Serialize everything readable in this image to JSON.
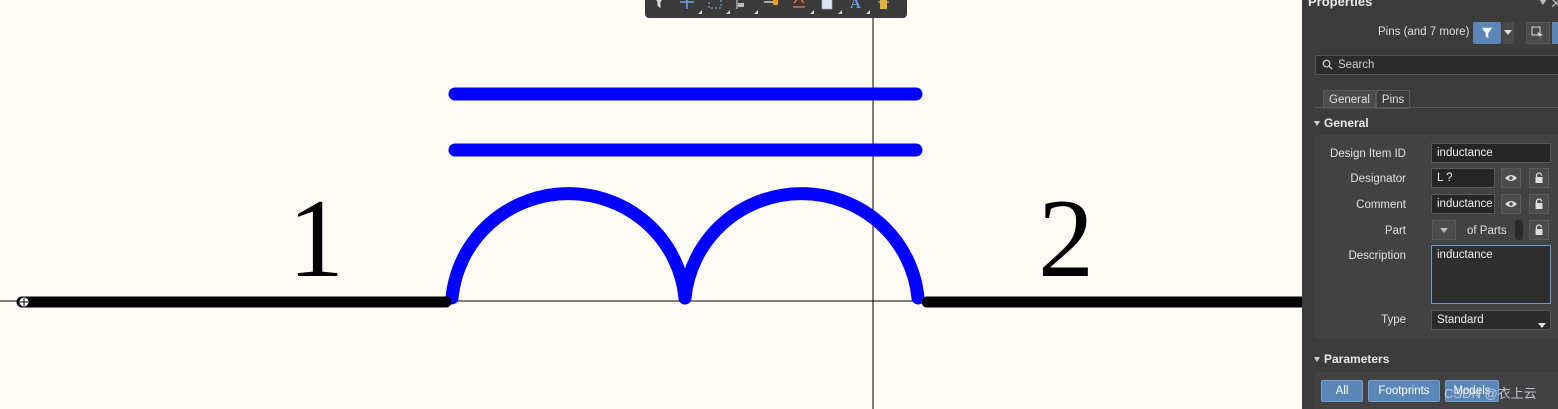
{
  "canvas": {
    "pin1_label": "1",
    "pin2_label": "2",
    "body_color": "#0000ff",
    "pin_color": "#000000",
    "background": "#fffcf5"
  },
  "toolbar": {
    "icons": [
      "filter-icon",
      "crosshair-icon",
      "select-region-icon",
      "align-icon",
      "place-pin-icon",
      "ieee-symbol-icon",
      "note-icon",
      "place-text-icon",
      "component-icon"
    ]
  },
  "properties": {
    "title": "Properties",
    "filter_summary": "Pins (and 7 more)",
    "search_placeholder": "Search",
    "tabs": [
      "General",
      "Pins"
    ],
    "general_section": "General",
    "fields": {
      "design_item_id_label": "Design Item ID",
      "design_item_id_value": "inductance",
      "designator_label": "Designator",
      "designator_value": "L ?",
      "comment_label": "Comment",
      "comment_value": "inductance",
      "part_label": "Part",
      "of_parts": "of Parts",
      "description_label": "Description",
      "description_value": "inductance",
      "type_label": "Type",
      "type_value": "Standard"
    },
    "parameters_section": "Parameters",
    "param_buttons": [
      "All",
      "Footprints",
      "Models"
    ],
    "watermark": "CSDN @衣上云"
  }
}
